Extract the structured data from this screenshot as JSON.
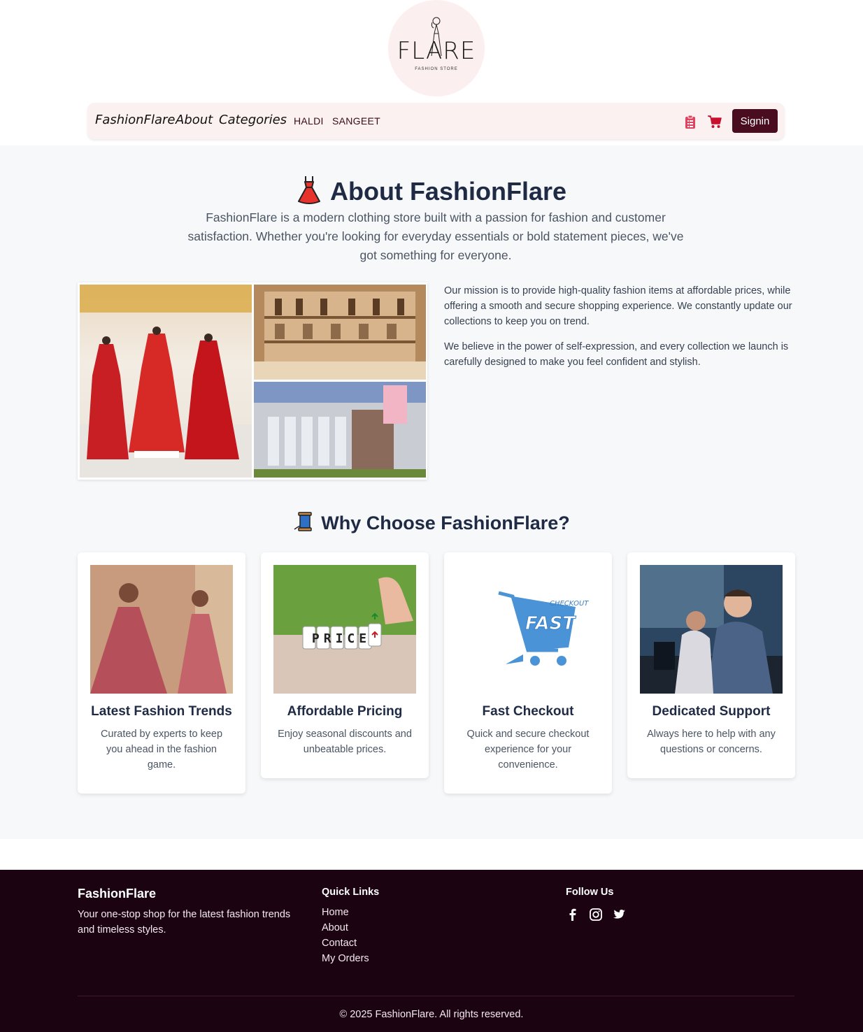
{
  "brand": {
    "logo_text": "FLARE",
    "logo_subtext": "FASHION STORE"
  },
  "nav": {
    "items": [
      {
        "label": "FashionFlare"
      },
      {
        "label": "About"
      },
      {
        "label": "Categories"
      }
    ],
    "categories": [
      "HALDI",
      "SANGEET"
    ],
    "icons": [
      "clipboard-icon",
      "cart-icon"
    ],
    "signin_label": "Signin"
  },
  "about": {
    "title": "About FashionFlare",
    "description": "FashionFlare is a modern clothing store built with a passion for fashion and customer satisfaction. Whether you're looking for everyday essentials or bold statement pieces, we've got something for everyone.",
    "mission": [
      "Our mission is to provide high-quality fashion items at affordable prices, while offering a smooth and secure shopping experience. We constantly update our collections to keep you on trend.",
      "We believe in the power of self-expression, and every collection we launch is carefully designed to make you feel confident and stylish."
    ]
  },
  "why": {
    "title": "Why Choose FashionFlare?",
    "cards": [
      {
        "title": "Latest Fashion Trends",
        "description": "Curated by experts to keep you ahead in the fashion game."
      },
      {
        "title": "Affordable Pricing",
        "description": "Enjoy seasonal discounts and unbeatable prices.",
        "image_text": "PRICE"
      },
      {
        "title": "Fast Checkout",
        "description": "Quick and secure checkout experience for your convenience.",
        "image_text_main": "FAST",
        "image_text_top": "CHECKOUT"
      },
      {
        "title": "Dedicated Support",
        "description": "Always here to help with any questions or concerns."
      }
    ]
  },
  "footer": {
    "brand": "FashionFlare",
    "tagline": "Your one-stop shop for the latest fashion trends and timeless styles.",
    "quick_links_title": "Quick Links",
    "quick_links": [
      "Home",
      "About",
      "Contact",
      "My Orders"
    ],
    "follow_title": "Follow Us",
    "social": [
      "facebook-icon",
      "instagram-icon",
      "twitter-icon"
    ],
    "copyright": "© 2025 FashionFlare. All rights reserved."
  },
  "colors": {
    "brand_dark": "#4a0c1f",
    "footer_bg": "#1b0312",
    "navbar_bg": "#fbf1f0",
    "heading": "#1f2a44"
  }
}
